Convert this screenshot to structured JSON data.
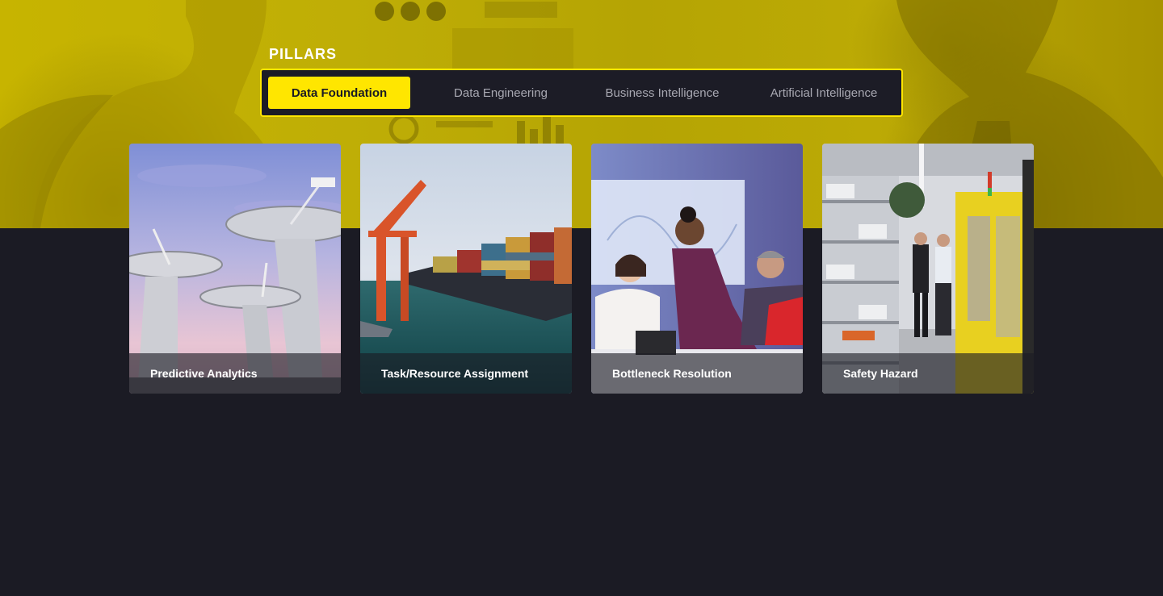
{
  "pillars": {
    "title": "PILLARS",
    "tabs": [
      {
        "label": "Data Foundation",
        "active": true
      },
      {
        "label": "Data Engineering",
        "active": false
      },
      {
        "label": "Business Intelligence",
        "active": false
      },
      {
        "label": "Artificial Intelligence",
        "active": false
      }
    ]
  },
  "cards": [
    {
      "title": "Predictive Analytics",
      "image": "satellite-dishes-photo"
    },
    {
      "title": "Task/Resource Assignment",
      "image": "container-ship-port-photo"
    },
    {
      "title": "Bottleneck Resolution",
      "image": "office-team-meeting-photo"
    },
    {
      "title": "Safety Hazard",
      "image": "factory-floor-photo"
    }
  ],
  "colors": {
    "accent": "#ffe600",
    "background": "#1b1b24",
    "tab_inactive_text": "#a8a8b2"
  }
}
